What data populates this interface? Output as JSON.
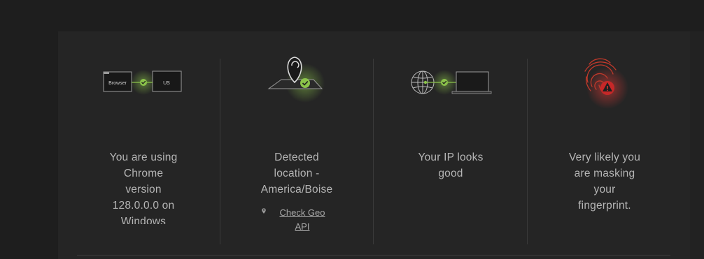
{
  "checks": [
    {
      "icon": "browser-to-location-icon",
      "lines": [
        "You are using",
        "Chrome",
        "version",
        "128.0.0.0 on",
        "Windows"
      ],
      "status": "ok",
      "illustration_labels": {
        "left_box": "Browser",
        "right_box": "US"
      }
    },
    {
      "icon": "location-pin-icon",
      "lines": [
        "Detected",
        "location -",
        "America/Boise"
      ],
      "status": "ok",
      "link_lines": [
        "Check Geo",
        "API"
      ]
    },
    {
      "icon": "globe-to-laptop-icon",
      "lines": [
        "Your IP looks",
        "good"
      ],
      "status": "ok"
    },
    {
      "icon": "fingerprint-warning-icon",
      "lines": [
        "Very likely you",
        "are masking",
        "your",
        "fingerprint."
      ],
      "status": "warning"
    }
  ],
  "colors": {
    "ok": "#8bc34a",
    "warning": "#e53935",
    "text": "#b5b5b5",
    "panel": "#252525",
    "background": "#1e1e1e"
  }
}
